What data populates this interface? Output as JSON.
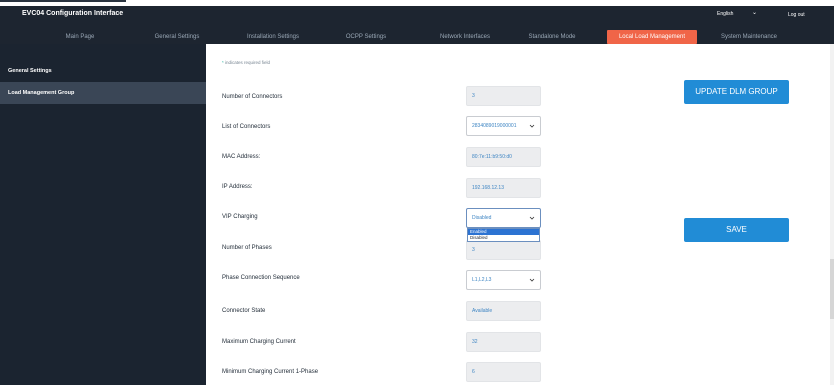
{
  "header": {
    "app_title": "EVC04 Configuration Interface",
    "language": "English",
    "logout": "Log out"
  },
  "nav": {
    "items": [
      "Main Page",
      "General Settings",
      "Installation Settings",
      "OCPP Settings",
      "Network Interfaces",
      "Standalone Mode",
      "Local Load Management",
      "System Maintenance"
    ],
    "active": "Local Load Management"
  },
  "sidebar": {
    "items": [
      "General Settings",
      "Load Management Group"
    ],
    "active": "Load Management Group"
  },
  "form": {
    "required_note": "indicates required field",
    "fields": [
      {
        "label": "Number of Connectors",
        "value": "3"
      },
      {
        "label": "List of Connectors",
        "value": "2834089019000001"
      },
      {
        "label": "MAC Address:",
        "value": "80:7e:11:b9:50:d0"
      },
      {
        "label": "IP Address:",
        "value": "192.168.12.13"
      },
      {
        "label": "VIP Charging",
        "value": "Disabled"
      },
      {
        "label": "Number of Phases",
        "value": "3"
      },
      {
        "label": "Phase Connection Sequence",
        "value": "L1,L2,L3"
      },
      {
        "label": "Connector State",
        "value": "Available"
      },
      {
        "label": "Maximum Charging Current",
        "value": "32"
      },
      {
        "label": "Minimum Charging Current 1-Phase",
        "value": "6"
      }
    ],
    "vip_options": [
      "Enabled",
      "Disabled"
    ],
    "vip_highlighted": "Enabled"
  },
  "buttons": {
    "update": "UPDATE DLM GROUP",
    "save": "SAVE"
  },
  "colors": {
    "topbar": "#1d2530",
    "sidebar": "#1b2430",
    "active_nav": "#f06548",
    "button": "#218cd6",
    "value_text": "#3e85c3"
  }
}
